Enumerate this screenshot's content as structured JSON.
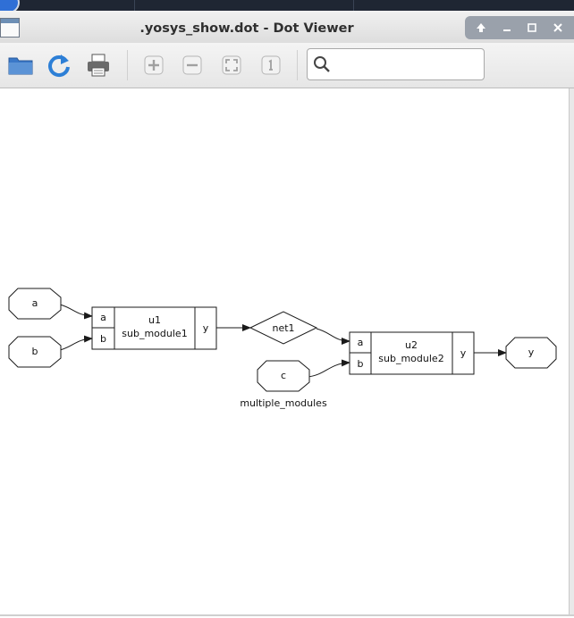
{
  "window": {
    "title": ".yosys_show.dot - Dot Viewer",
    "controls": [
      "up-arrow-icon",
      "minimize-icon",
      "maximize-icon",
      "close-icon"
    ]
  },
  "toolbar": {
    "buttons": [
      "open-folder-icon",
      "reload-icon",
      "print-icon",
      "zoom-in-icon",
      "zoom-out-icon",
      "zoom-fit-icon",
      "zoom-100-icon"
    ],
    "search_value": "",
    "search_placeholder": ""
  },
  "graph": {
    "module_name": "multiple_modules",
    "inputs": [
      "a",
      "b",
      "c"
    ],
    "output": "y",
    "wire": "net1",
    "cells": [
      {
        "instance": "u1",
        "type": "sub_module1",
        "ports_in": [
          "a",
          "b"
        ],
        "port_out": "y"
      },
      {
        "instance": "u2",
        "type": "sub_module2",
        "ports_in": [
          "a",
          "b"
        ],
        "port_out": "y"
      }
    ]
  },
  "colors": {
    "titlebar": "#e6e6e6",
    "controls_bg": "#9aa1ab",
    "toolbar_icon_blue": "#3a78c8",
    "graph_stroke": "#1a1a1a"
  }
}
